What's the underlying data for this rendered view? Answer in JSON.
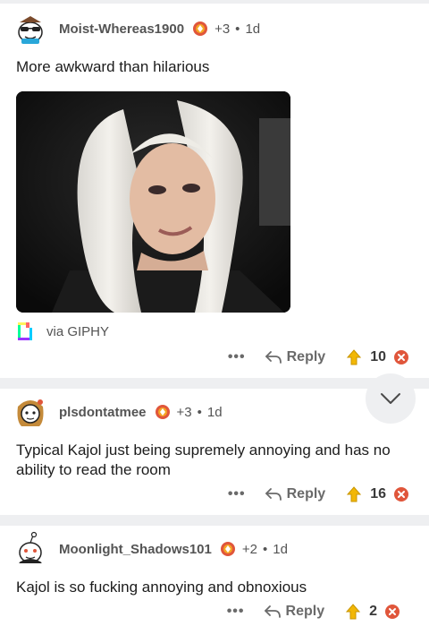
{
  "comments": [
    {
      "username": "Moist-Whereas1900",
      "award_count": "+3",
      "age": "1d",
      "body": "More awkward than hilarious",
      "media_source": "via GIPHY",
      "reply_label": "Reply",
      "score": "10",
      "more_label": "•••"
    },
    {
      "username": "plsdontatmee",
      "award_count": "+3",
      "age": "1d",
      "body": "Typical Kajol just being supremely annoying and has no ability to read the room",
      "reply_label": "Reply",
      "score": "16",
      "more_label": "•••"
    },
    {
      "username": "Moonlight_Shadows101",
      "award_count": "+2",
      "age": "1d",
      "body": "Kajol is so fucking annoying and obnoxious",
      "reply_label": "Reply",
      "score": "2",
      "more_label": "•••"
    }
  ],
  "separator_dot": "•",
  "colors": {
    "upvote": "#f2b705",
    "downvote": "#e0563b",
    "award": "#e0563b",
    "separator": "#eeeff1"
  }
}
